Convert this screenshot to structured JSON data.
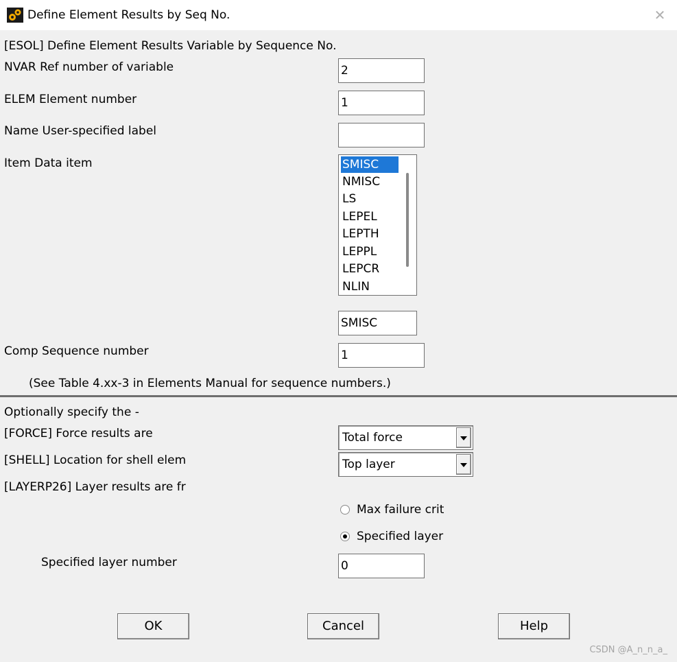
{
  "window": {
    "title": "Define Element Results by Seq No.",
    "close_glyph": "✕"
  },
  "header": "[ESOL]  Define  Element Results Variable by Sequence No.",
  "fields": {
    "nvar": {
      "label": "NVAR  Ref number of variable",
      "value": "2"
    },
    "elem": {
      "label": "ELEM  Element number",
      "value": "1"
    },
    "name": {
      "label": "Name  User-specified label",
      "value": ""
    },
    "item": {
      "label": "Item  Data item",
      "options": [
        "SMISC",
        "NMISC",
        "LS",
        "LEPEL",
        "LEPTH",
        "LEPPL",
        "LEPCR",
        "NLIN"
      ],
      "selected": "SMISC",
      "value": "SMISC"
    },
    "comp": {
      "label": "Comp  Sequence number",
      "value": "1"
    }
  },
  "note": "(See Table 4.xx-3 in Elements Manual for sequence numbers.)",
  "optional": {
    "heading": "Optionally specify the -",
    "force": {
      "label": "[FORCE]  Force results are",
      "value": "Total force"
    },
    "shell": {
      "label": "[SHELL]  Location for shell elem",
      "value": "Top layer"
    },
    "layerp26": {
      "label": "[LAYERP26]  Layer results are fr",
      "options": [
        {
          "label": "Max failure crit",
          "checked": false
        },
        {
          "label": "Specified layer",
          "checked": true
        }
      ]
    },
    "layer_number": {
      "label": "Specified layer number",
      "value": "0"
    }
  },
  "buttons": {
    "ok": "OK",
    "cancel": "Cancel",
    "help": "Help"
  },
  "watermark": "CSDN @A_n_n_a_",
  "colors": {
    "selection": "#1e78d7",
    "background": "#f0f0f0"
  }
}
